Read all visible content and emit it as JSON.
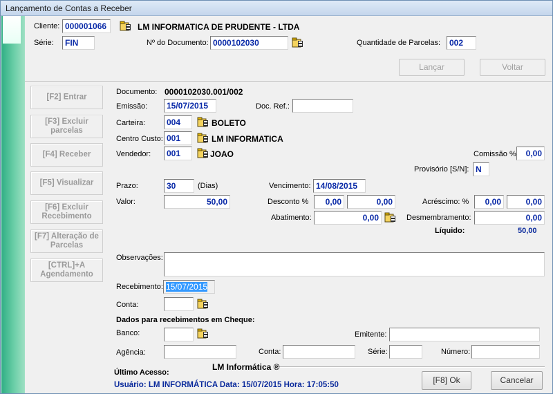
{
  "window": {
    "title": "Lançamento de Contas a Receber"
  },
  "header": {
    "cliente_label": "Cliente:",
    "cliente_code": "000001066",
    "cliente_name": "LM INFORMATICA DE PRUDENTE - LTDA",
    "serie_label": "Série:",
    "serie_value": "FIN",
    "documento_label": "Nº do Documento:",
    "documento_value": "0000102030",
    "parcelas_label": "Quantidade de Parcelas:",
    "parcelas_value": "002",
    "lancar_label": "Lançar",
    "voltar_label": "Voltar"
  },
  "sidebar": {
    "items": [
      {
        "label": "[F2]   Entrar"
      },
      {
        "label": "[F3]   Excluir parcelas"
      },
      {
        "label": "[F4]   Receber"
      },
      {
        "label": "[F5]   Visualizar"
      },
      {
        "label": "[F6]   Excluir Recebimento"
      },
      {
        "label": "[F7]   Alteração de Parcelas"
      },
      {
        "label": "[CTRL]+A Agendamento"
      }
    ]
  },
  "form": {
    "documento_label": "Documento:",
    "documento_value": "0000102030.001/002",
    "emissao_label": "Emissão:",
    "emissao_value": "15/07/2015",
    "docref_label": "Doc. Ref.:",
    "docref_value": "",
    "carteira_label": "Carteira:",
    "carteira_code": "004",
    "carteira_name": "BOLETO",
    "centro_label": "Centro Custo:",
    "centro_code": "001",
    "centro_name": "LM INFORMATICA",
    "vendedor_label": "Vendedor:",
    "vendedor_code": "001",
    "vendedor_name": "JOAO",
    "comissao_label": "Comissão %:",
    "comissao_value": "0,00",
    "provisorio_label": "Provisório [S/N]:",
    "provisorio_value": "N",
    "prazo_label": "Prazo:",
    "prazo_value": "30",
    "prazo_unit": "(Dias)",
    "vencimento_label": "Vencimento:",
    "vencimento_value": "14/08/2015",
    "valor_label": "Valor:",
    "valor_value": "50,00",
    "desconto_label": "Desconto %",
    "desconto_pct": "0,00",
    "desconto_value": "0,00",
    "acrescimo_label": "Acréscimo: %",
    "acrescimo_pct": "0,00",
    "acrescimo_value": "0,00",
    "abatimento_label": "Abatimento:",
    "abatimento_value": "0,00",
    "desmembramento_label": "Desmembramento:",
    "desmembramento_value": "0,00",
    "liquido_label": "Líquido:",
    "liquido_value": "50,00",
    "observacoes_label": "Observações:",
    "observacoes_value": "",
    "recebimento_label": "Recebimento:",
    "recebimento_value": "15/07/2015",
    "conta_label": "Conta:",
    "conta_value": ""
  },
  "cheque": {
    "section_title": "Dados para recebimentos em Cheque:",
    "banco_label": "Banco:",
    "banco_value": "",
    "emitente_label": "Emitente:",
    "emitente_value": "",
    "agencia_label": "Agência:",
    "agencia_value": "",
    "conta_label": "Conta:",
    "conta_value": "",
    "serie_label": "Série:",
    "serie_value": "",
    "numero_label": "Número:",
    "numero_value": ""
  },
  "footer": {
    "brand": "LM Informática ®",
    "ultimo_acesso_label": "Último Acesso:",
    "usuario_line": "Usuário: LM INFORMÁTICA  Data: 15/07/2015  Hora: 17:05:50",
    "ok_label": "[F8]   Ok",
    "cancelar_label": "Cancelar"
  },
  "icons": {
    "lookup": "lookup-folder-icon"
  }
}
